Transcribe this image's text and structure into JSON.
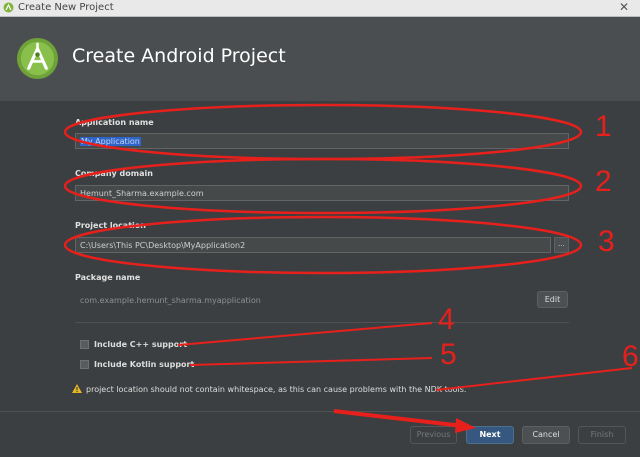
{
  "window": {
    "title": "Create New Project",
    "close_glyph": "✕"
  },
  "header": {
    "title": "Create Android Project",
    "logo_icon": "android-studio-logo"
  },
  "form": {
    "app_name": {
      "label": "Application name",
      "value": "My Application"
    },
    "company_domain": {
      "label": "Company domain",
      "value": "Hemunt_Sharma.example.com"
    },
    "project_location": {
      "label": "Project location",
      "value": "C:\\Users\\This PC\\Desktop\\MyApplication2",
      "browse_label": "..."
    },
    "package_name": {
      "label": "Package name",
      "value": "com.example.hemunt_sharma.myapplication",
      "edit_label": "Edit"
    },
    "include_cpp": {
      "label": "Include C++ support",
      "checked": false
    },
    "include_kotlin": {
      "label": "Include Kotlin support",
      "checked": false
    },
    "warning": "project location should not contain whitespace, as this can cause problems with the NDK tools."
  },
  "footer": {
    "previous": "Previous",
    "next": "Next",
    "cancel": "Cancel",
    "finish": "Finish"
  },
  "annotations": {
    "numbers": [
      "1",
      "2",
      "3",
      "4",
      "5",
      "6"
    ],
    "color": "#e8201c"
  }
}
